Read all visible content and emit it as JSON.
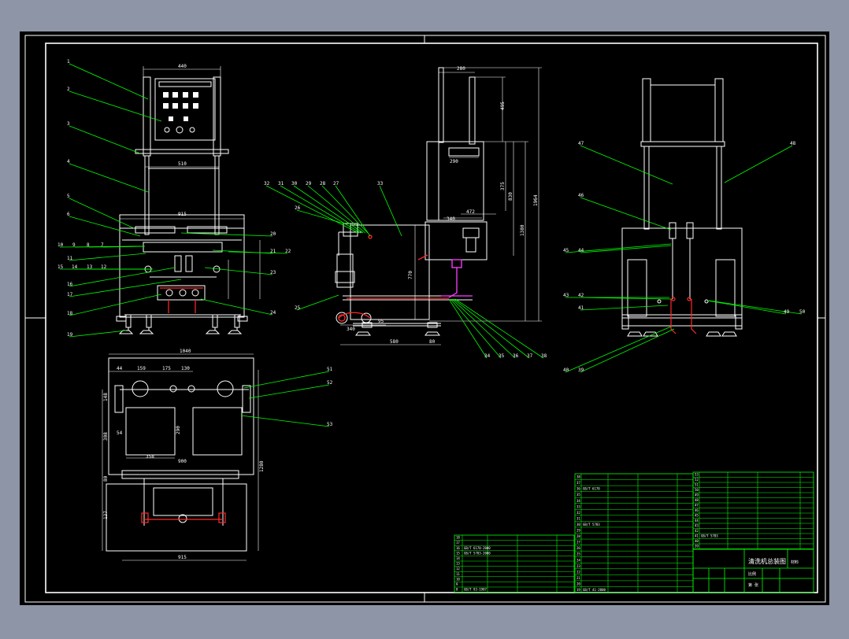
{
  "canvas": {
    "background": "#000000",
    "frame_color": "#ffffff",
    "viewport_color": "#8e95a6"
  },
  "colors": {
    "outline": "#ffffff",
    "leader": "#00ff00",
    "dimension": "#ffffff",
    "pipe_red": "#ff2a2a",
    "pipe_magenta": "#ff40ff",
    "table": "#00ff00",
    "table_text": "#ffffff"
  },
  "dimensions": {
    "front_top_width": "440",
    "front_mid_width": "510",
    "front_base_width": "915",
    "side_top_width": "280",
    "side_mid_width": "290",
    "side_right_1": "495",
    "side_right_2": "375",
    "side_right_3": "830",
    "side_right_4": "1380",
    "side_right_5": "1964",
    "side_inner": "340",
    "side_inner_2": "472",
    "side_bottom_1": "340",
    "side_bottom_2": "580",
    "side_bottom_3": "80",
    "side_bottom_4": "95",
    "side_height_left": "770",
    "top_overall": "1040",
    "top_a": "44",
    "top_b": "159",
    "top_c": "175",
    "top_d": "130",
    "top_left": "148",
    "top_box_w": "358",
    "top_box_h": "290",
    "top_side_1": "54",
    "top_side_2": "308",
    "top_side_3": "80",
    "top_side_4": "1280",
    "top_bottom_1": "137",
    "top_bottom_2": "915",
    "top_inner_900": "900"
  },
  "balloons": {
    "front_left": [
      "1",
      "2",
      "3",
      "4",
      "5",
      "6",
      "10",
      "9",
      "8",
      "7",
      "11",
      "15",
      "14",
      "13",
      "12",
      "16",
      "17",
      "18",
      "19"
    ],
    "front_right": [
      "20",
      "21",
      "22",
      "23",
      "24"
    ],
    "side_top": [
      "32",
      "31",
      "30",
      "29",
      "28",
      "27",
      "33"
    ],
    "side_left": [
      "26",
      "25"
    ],
    "side_bottom": [
      "34",
      "35",
      "36",
      "37",
      "38"
    ],
    "rear_left": [
      "47",
      "46",
      "45",
      "44",
      "43",
      "42",
      "41"
    ],
    "rear_right": [
      "48",
      "49",
      "50"
    ],
    "rear_bottom": [
      "40",
      "39"
    ],
    "plan": [
      "51",
      "52",
      "53"
    ]
  },
  "title_block": {
    "drawing_title": "清洗机总装图",
    "scale_label": "比例",
    "sheet_label": "第 张",
    "material_label": "材料"
  },
  "bom_left": [
    {
      "no": "18",
      "code": "",
      "name": "",
      "qty": "",
      "mat": ""
    },
    {
      "no": "17",
      "code": "",
      "name": "",
      "qty": "",
      "mat": ""
    },
    {
      "no": "16",
      "code": "GB/T 6170-2000",
      "name": "",
      "qty": "",
      "mat": ""
    },
    {
      "no": "15",
      "code": "GB/T 5783-2000",
      "name": "",
      "qty": "",
      "mat": ""
    },
    {
      "no": "14",
      "code": "",
      "name": "",
      "qty": "",
      "mat": ""
    },
    {
      "no": "13",
      "code": "",
      "name": "",
      "qty": "",
      "mat": ""
    },
    {
      "no": "12",
      "code": "",
      "name": "",
      "qty": "",
      "mat": ""
    },
    {
      "no": "11",
      "code": "",
      "name": "",
      "qty": "",
      "mat": ""
    },
    {
      "no": "10",
      "code": "",
      "name": "",
      "qty": "",
      "mat": ""
    },
    {
      "no": "9",
      "code": "",
      "name": "",
      "qty": "",
      "mat": ""
    },
    {
      "no": "8",
      "code": "GB/T 93-1987",
      "name": "",
      "qty": "",
      "mat": ""
    }
  ],
  "bom_mid": [
    {
      "no": "38",
      "code": "",
      "name": "",
      "qty": "",
      "mat": ""
    },
    {
      "no": "37",
      "code": "",
      "name": "",
      "qty": "",
      "mat": ""
    },
    {
      "no": "36",
      "code": "GB/T 6170",
      "name": "",
      "qty": "",
      "mat": ""
    },
    {
      "no": "35",
      "code": "",
      "name": "",
      "qty": "",
      "mat": ""
    },
    {
      "no": "34",
      "code": "",
      "name": "",
      "qty": "",
      "mat": ""
    },
    {
      "no": "33",
      "code": "",
      "name": "",
      "qty": "",
      "mat": ""
    },
    {
      "no": "32",
      "code": "",
      "name": "",
      "qty": "",
      "mat": ""
    },
    {
      "no": "31",
      "code": "",
      "name": "",
      "qty": "",
      "mat": ""
    },
    {
      "no": "30",
      "code": "GB/T 5783",
      "name": "",
      "qty": "",
      "mat": ""
    },
    {
      "no": "29",
      "code": "",
      "name": "",
      "qty": "",
      "mat": ""
    },
    {
      "no": "28",
      "code": "",
      "name": "",
      "qty": "",
      "mat": ""
    },
    {
      "no": "27",
      "code": "",
      "name": "",
      "qty": "",
      "mat": ""
    },
    {
      "no": "26",
      "code": "",
      "name": "",
      "qty": "",
      "mat": ""
    },
    {
      "no": "25",
      "code": "",
      "name": "",
      "qty": "",
      "mat": ""
    },
    {
      "no": "24",
      "code": "",
      "name": "",
      "qty": "",
      "mat": ""
    },
    {
      "no": "23",
      "code": "",
      "name": "",
      "qty": "",
      "mat": ""
    },
    {
      "no": "22",
      "code": "",
      "name": "",
      "qty": "",
      "mat": ""
    },
    {
      "no": "21",
      "code": "",
      "name": "",
      "qty": "",
      "mat": ""
    },
    {
      "no": "20",
      "code": "",
      "name": "",
      "qty": "",
      "mat": ""
    },
    {
      "no": "19",
      "code": "GB/T 41-2000",
      "name": "",
      "qty": "",
      "mat": ""
    }
  ],
  "bom_right": [
    {
      "no": "53",
      "code": "",
      "name": "",
      "qty": "",
      "mat": ""
    },
    {
      "no": "52",
      "code": "",
      "name": "",
      "qty": "",
      "mat": ""
    },
    {
      "no": "51",
      "code": "",
      "name": "",
      "qty": "",
      "mat": ""
    },
    {
      "no": "50",
      "code": "",
      "name": "",
      "qty": "",
      "mat": ""
    },
    {
      "no": "49",
      "code": "",
      "name": "",
      "qty": "",
      "mat": ""
    },
    {
      "no": "48",
      "code": "",
      "name": "",
      "qty": "",
      "mat": ""
    },
    {
      "no": "47",
      "code": "",
      "name": "",
      "qty": "",
      "mat": ""
    },
    {
      "no": "46",
      "code": "",
      "name": "",
      "qty": "",
      "mat": ""
    },
    {
      "no": "45",
      "code": "",
      "name": "",
      "qty": "",
      "mat": ""
    },
    {
      "no": "44",
      "code": "",
      "name": "",
      "qty": "",
      "mat": ""
    },
    {
      "no": "43",
      "code": "",
      "name": "",
      "qty": "",
      "mat": ""
    },
    {
      "no": "42",
      "code": "",
      "name": "",
      "qty": "",
      "mat": ""
    },
    {
      "no": "41",
      "code": "GB/T 5783",
      "name": "",
      "qty": "",
      "mat": ""
    },
    {
      "no": "40",
      "code": "",
      "name": "",
      "qty": "",
      "mat": ""
    },
    {
      "no": "39",
      "code": "",
      "name": "",
      "qty": "",
      "mat": ""
    }
  ]
}
